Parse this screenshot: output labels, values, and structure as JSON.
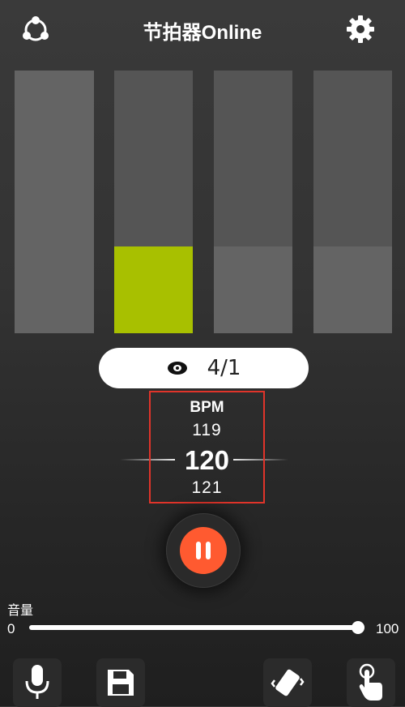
{
  "header": {
    "title": "节拍器Online",
    "share_icon": "share-icon",
    "settings_icon": "gear-icon"
  },
  "beats": {
    "count": 4,
    "active_index": 1,
    "levels": [
      1.0,
      0.33,
      0.33,
      0.33
    ],
    "active_color": "#a8c000",
    "inactive_color": "#646464"
  },
  "time_signature": {
    "icon": "eye-icon",
    "value": "4/1"
  },
  "bpm": {
    "label": "BPM",
    "prev": "119",
    "current": "120",
    "next": "121",
    "highlight_color": "#e0342a"
  },
  "playback": {
    "state": "playing",
    "icon": "pause-icon",
    "color": "#ff5a30"
  },
  "volume": {
    "label": "音量",
    "min": "0",
    "max": "100",
    "value": 100
  },
  "toolbar": {
    "items": [
      "microphone-icon",
      "save-icon",
      "vibrate-icon",
      "tap-icon"
    ]
  }
}
